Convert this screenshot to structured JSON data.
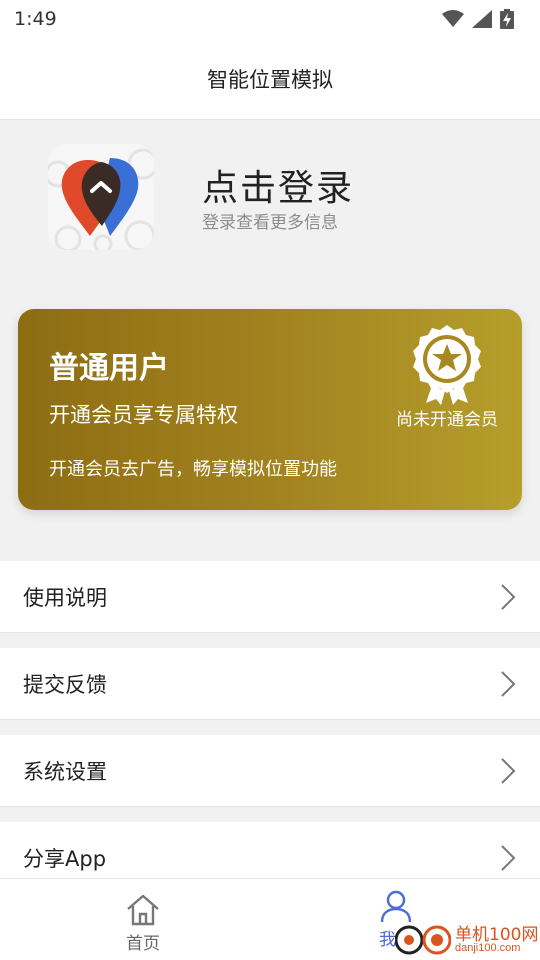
{
  "status_bar": {
    "time": "1:49",
    "icons": [
      "wifi-icon",
      "signal-icon",
      "battery-charging-icon"
    ]
  },
  "header": {
    "title": "智能位置模拟"
  },
  "profile": {
    "login_title": "点击登录",
    "login_subtitle": "登录查看更多信息",
    "logo_icon": "location-pin-logo-icon"
  },
  "member_card": {
    "level": "普通用户",
    "slogan": "开通会员享专属特权",
    "benefit": "开通会员去广告，畅享模拟位置功能",
    "badge_status": "尚未开通会员",
    "badge_icon": "star-badge-icon",
    "gradient_colors": [
      "#8d6d12",
      "#b59f2b"
    ]
  },
  "menu": {
    "items": [
      {
        "label": "使用说明"
      },
      {
        "label": "提交反馈"
      },
      {
        "label": "系统设置"
      },
      {
        "label": "分享App"
      }
    ]
  },
  "bottom_nav": {
    "items": [
      {
        "label": "首页",
        "icon": "home-icon",
        "active": false
      },
      {
        "label": "我的",
        "icon": "person-icon",
        "active": true
      }
    ],
    "active_color": "#4a6cd4"
  },
  "watermark": {
    "text": "单机100网",
    "url_text": "danji100.com"
  }
}
